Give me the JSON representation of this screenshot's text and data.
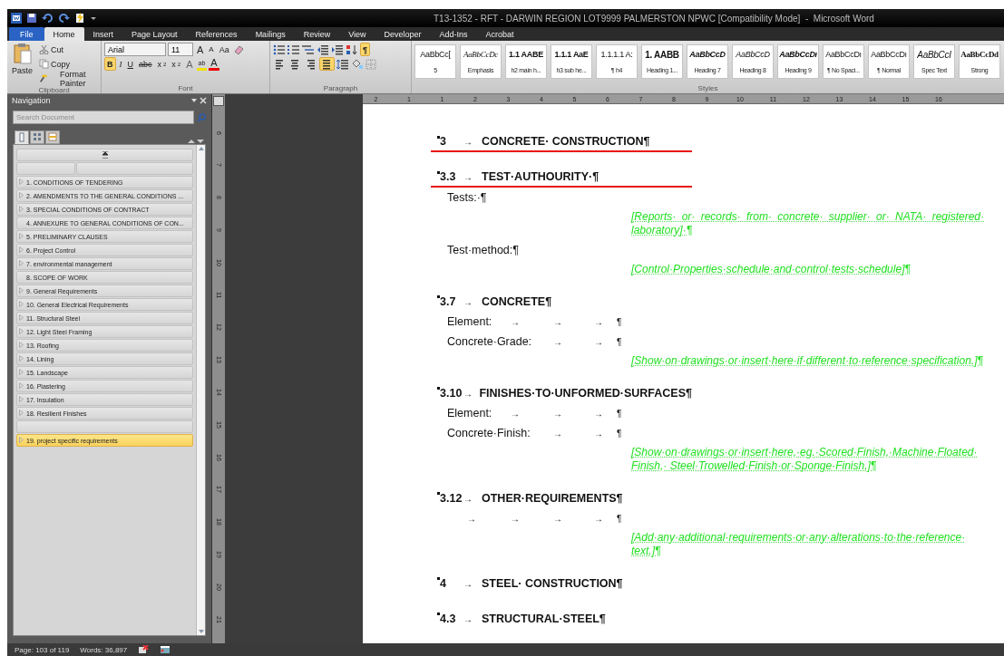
{
  "window": {
    "title": "T13-1352 - RFT - DARWIN REGION LOT9999 PALMERSTON NPWC [Compatibility Mode]  -  Microsoft Word"
  },
  "ribbon_tabs": [
    {
      "label": "File",
      "kind": "file",
      "selected": false
    },
    {
      "label": "Home",
      "kind": "tab",
      "selected": true
    },
    {
      "label": "Insert",
      "kind": "tab",
      "selected": false
    },
    {
      "label": "Page Layout",
      "kind": "tab",
      "selected": false
    },
    {
      "label": "References",
      "kind": "tab",
      "selected": false
    },
    {
      "label": "Mailings",
      "kind": "tab",
      "selected": false
    },
    {
      "label": "Review",
      "kind": "tab",
      "selected": false
    },
    {
      "label": "View",
      "kind": "tab",
      "selected": false
    },
    {
      "label": "Developer",
      "kind": "tab",
      "selected": false
    },
    {
      "label": "Add-Ins",
      "kind": "tab",
      "selected": false
    },
    {
      "label": "Acrobat",
      "kind": "tab",
      "selected": false
    }
  ],
  "clipboard": {
    "label": "Clipboard",
    "paste": "Paste",
    "cut": "Cut",
    "copy": "Copy",
    "format_painter": "Format Painter"
  },
  "font": {
    "label": "Font",
    "name": "Arial",
    "size": "11",
    "grow": "A",
    "shrink": "A",
    "case": "Aa",
    "formats": [
      {
        "label": "B",
        "kind": "bold",
        "on": true
      },
      {
        "label": "I",
        "kind": "italic",
        "on": false
      },
      {
        "label": "U",
        "kind": "underline",
        "on": false
      },
      {
        "label": "abc",
        "kind": "strike",
        "on": false
      },
      {
        "label": "x",
        "sub": "2",
        "kind": "subscript",
        "on": false
      },
      {
        "label": "x",
        "sub": "2",
        "kind": "superscript",
        "on": false
      }
    ],
    "effects": "A",
    "highlight": "ab",
    "font_color": "A"
  },
  "paragraph": {
    "label": "Paragraph",
    "show_marks": "¶",
    "show_marks_on": true,
    "align": [
      {
        "kind": "left",
        "selected": false
      },
      {
        "kind": "center",
        "selected": false
      },
      {
        "kind": "right",
        "selected": false
      },
      {
        "kind": "justify",
        "selected": true
      }
    ]
  },
  "styles": {
    "label": "Styles",
    "items": [
      {
        "preview": "AaBbCc[",
        "name": "5",
        "kind": "plain"
      },
      {
        "preview": "AaBbCcDc",
        "name": "Emphasis",
        "kind": "serif-italic"
      },
      {
        "preview": "1.1  AABE",
        "name": "h2 main h...",
        "kind": "bold"
      },
      {
        "preview": "1.1.1  AaE",
        "name": "h3 sub he...",
        "kind": "bold"
      },
      {
        "preview": "1.1.1.1  A:",
        "name": "¶ h4",
        "kind": "plain"
      },
      {
        "preview": "1.  AABB",
        "name": "Heading 1...",
        "kind": "bold-large"
      },
      {
        "preview": "AaBbCcD",
        "name": "Heading 7",
        "kind": "bold-italic"
      },
      {
        "preview": "AaBbCcD",
        "name": "Heading 8",
        "kind": "italic"
      },
      {
        "preview": "AaBbCcDı",
        "name": "Heading 9",
        "kind": "bold-italic"
      },
      {
        "preview": "AaBbCcDı",
        "name": "¶ No Spaci...",
        "kind": "plain"
      },
      {
        "preview": "AaBbCcDı",
        "name": "¶ Normal",
        "kind": "plain"
      },
      {
        "preview": "AaBbCcI",
        "name": "Spec Text",
        "kind": "italic-large"
      },
      {
        "preview": "AaBbCcDd",
        "name": "Strong",
        "kind": "serif-bold"
      }
    ]
  },
  "navigation": {
    "title": "Navigation",
    "placeholder": "Search Document",
    "views": [
      {
        "kind": "headings",
        "selected": true
      },
      {
        "kind": "pages",
        "selected": false
      },
      {
        "kind": "results",
        "selected": false
      }
    ],
    "items": [
      {
        "kind": "heading",
        "text": "1. CONDITIONS OF TENDERING",
        "has_children": true,
        "selected": false
      },
      {
        "kind": "heading",
        "text": "2. AMENDMENTS TO THE GENERAL CONDITIONS ...",
        "has_children": true,
        "selected": false
      },
      {
        "kind": "heading",
        "text": "3. SPECIAL CONDITIONS OF CONTRACT",
        "has_children": true,
        "selected": false
      },
      {
        "kind": "heading",
        "text": "4. ANNEXURE TO GENERAL CONDITIONS OF CON...",
        "has_children": false,
        "selected": false
      },
      {
        "kind": "heading",
        "text": "5. PRELIMINARY CLAUSES",
        "has_children": true,
        "selected": false
      },
      {
        "kind": "heading",
        "text": "6. Project Control",
        "has_children": true,
        "selected": false
      },
      {
        "kind": "heading",
        "text": "7. environmental management",
        "has_children": true,
        "selected": false
      },
      {
        "kind": "heading",
        "text": "8. SCOPE OF WORK",
        "has_children": false,
        "selected": false
      },
      {
        "kind": "heading",
        "text": "9. General Requirements",
        "has_children": true,
        "selected": false
      },
      {
        "kind": "heading",
        "text": "10. General Electrical Requirements",
        "has_children": true,
        "selected": false
      },
      {
        "kind": "heading",
        "text": "11. Structural Steel",
        "has_children": true,
        "selected": false
      },
      {
        "kind": "heading",
        "text": "12. Light Steel Framing",
        "has_children": true,
        "selected": false
      },
      {
        "kind": "heading",
        "text": "13. Roofing",
        "has_children": true,
        "selected": false
      },
      {
        "kind": "heading",
        "text": "14. Lining",
        "has_children": true,
        "selected": false
      },
      {
        "kind": "heading",
        "text": "15. Landscape",
        "has_children": true,
        "selected": false
      },
      {
        "kind": "heading",
        "text": "16. Plastering",
        "has_children": true,
        "selected": false
      },
      {
        "kind": "heading",
        "text": "17. Insulation",
        "has_children": true,
        "selected": false
      },
      {
        "kind": "heading",
        "text": "18. Resilient Finishes",
        "has_children": true,
        "selected": false
      },
      {
        "kind": "blank"
      },
      {
        "kind": "heading",
        "text": "19. project specific requirements",
        "has_children": true,
        "selected": true
      }
    ]
  },
  "horizontal_ruler": [
    "2",
    "1",
    "1",
    "2",
    "3",
    "4",
    "5",
    "6",
    "7",
    "8",
    "9",
    "10",
    "11",
    "12",
    "13",
    "14",
    "15",
    "16"
  ],
  "vertical_ruler": [
    "6",
    "7",
    "8",
    "9",
    "10",
    "11",
    "12",
    "13",
    "14",
    "15",
    "16",
    "17",
    "18",
    "19",
    "20",
    "21"
  ],
  "document": [
    {
      "kind": "heading",
      "number": "3",
      "arrow": "→",
      "title": "CONCRETE· CONSTRUCTION¶",
      "underline": true
    },
    {
      "kind": "heading",
      "number": "3.3",
      "arrow": "→",
      "title": "TEST·AUTHOURITY·¶",
      "underline": true
    },
    {
      "kind": "row",
      "cells": [
        "Tests:·¶"
      ]
    },
    {
      "kind": "guidance",
      "text": "[Reports· or· records· from· concrete· supplier· or· NATA· registered· laboratory]·¶"
    },
    {
      "kind": "row",
      "cells": [
        "Test·method:¶"
      ]
    },
    {
      "kind": "guidance",
      "text": "[Control·Properties·schedule·and·control·tests·schedule]¶"
    },
    {
      "kind": "heading",
      "number": "3.7",
      "arrow": "→",
      "title": "CONCRETE¶",
      "underline": false
    },
    {
      "kind": "row",
      "cells": [
        "Element:",
        "→",
        "→",
        "→",
        "¶"
      ]
    },
    {
      "kind": "row",
      "cells": [
        "Concrete·Grade:",
        "→",
        "→",
        "¶"
      ]
    },
    {
      "kind": "guidance",
      "text": "[Show·on·drawings·or·insert·here·if·different·to·reference·specification.]¶"
    },
    {
      "kind": "heading",
      "number": "3.10",
      "arrow": "→",
      "title": "FINISHES·TO·UNFORMED·SURFACES¶",
      "underline": false
    },
    {
      "kind": "row",
      "cells": [
        "Element:",
        "→",
        "→",
        "→",
        "¶"
      ]
    },
    {
      "kind": "row",
      "cells": [
        "Concrete·Finish:",
        "→",
        "→",
        "¶"
      ]
    },
    {
      "kind": "guidance",
      "text": "[Show·on·drawings·or·insert·here,·eg.·Scored·Finish,·Machine·Floated· Finish,· Steel·Trowelled·Finish·or·Sponge·Finish.]¶"
    },
    {
      "kind": "heading",
      "number": "3.12",
      "arrow": "→",
      "title": "OTHER·REQUIREMENTS¶",
      "underline": false
    },
    {
      "kind": "row",
      "cells": [
        "→",
        "→",
        "→",
        "→",
        "¶"
      ]
    },
    {
      "kind": "guidance",
      "text": "[Add·any·additional·requirements·or·any·alterations·to·the·reference· text.]¶"
    },
    {
      "kind": "heading",
      "number": "4",
      "arrow": "→",
      "title": "STEEL· CONSTRUCTION¶",
      "underline": false
    },
    {
      "kind": "heading",
      "number": "4.3",
      "arrow": "→",
      "title": "STRUCTURAL·STEEL¶",
      "underline": false
    }
  ],
  "status_bar": {
    "page": "Page: 103 of 119",
    "words": "Words: 36,897"
  }
}
